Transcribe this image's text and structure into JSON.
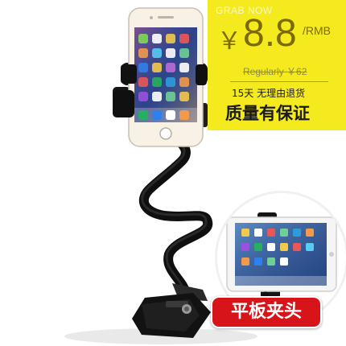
{
  "banner": {
    "grab_now": "GRAB NOW",
    "currency": "￥",
    "price": "8.8",
    "unit": "/RMB",
    "regular": "Regularly ￥62",
    "returns": "15天 无理由退货",
    "quality": "质量有保证"
  },
  "inset": {
    "label": "平板夹头"
  },
  "colors": {
    "banner_yellow": "#f4ea1d",
    "price_text": "#7a6a00",
    "tag_red": "#d8141b",
    "holder_black": "#111111"
  }
}
